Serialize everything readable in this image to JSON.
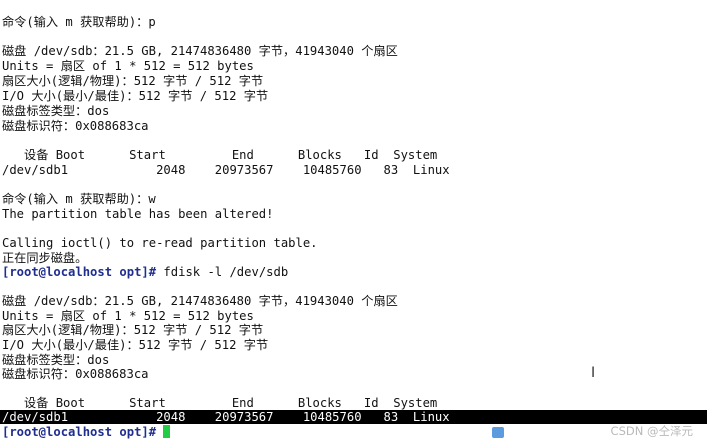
{
  "terminal": {
    "block1": {
      "cmd_prompt_line": "命令(输入 m 获取帮助)：p",
      "disk_line": "磁盘 /dev/sdb：21.5 GB, 21474836480 字节，41943040 个扇区",
      "units_line": "Units = 扇区 of 1 * 512 = 512 bytes",
      "sector_size_line": "扇区大小(逻辑/物理)：512 字节 / 512 字节",
      "io_size_line": "I/O 大小(最小/最佳)：512 字节 / 512 字节",
      "label_type_line": "磁盘标签类型：dos",
      "identifier_line": "磁盘标识符：0x088683ca",
      "table_header": "   设备 Boot      Start         End      Blocks   Id  System",
      "table_row": "/dev/sdb1            2048    20973567    10485760   83  Linux"
    },
    "write_cmd_line": "命令(输入 m 获取帮助)：w",
    "altered_line": "The partition table has been altered!",
    "ioctl_line": "Calling ioctl() to re-read partition table.",
    "sync_line": "正在同步磁盘。",
    "prompt1": "[root@localhost opt]#",
    "command1": " fdisk -l /dev/sdb",
    "block2": {
      "disk_line": "磁盘 /dev/sdb：21.5 GB, 21474836480 字节，41943040 个扇区",
      "units_line": "Units = 扇区 of 1 * 512 = 512 bytes",
      "sector_size_line": "扇区大小(逻辑/物理)：512 字节 / 512 字节",
      "io_size_line": "I/O 大小(最小/最佳)：512 字节 / 512 字节",
      "label_type_line": "磁盘标签类型：dos",
      "identifier_line": "磁盘标识符：0x088683ca",
      "table_header": "   设备 Boot      Start         End      Blocks   Id  System",
      "table_row": "/dev/sdb1            2048    20973567    10485760   83  Linux"
    },
    "prompt2": "[root@localhost opt]#",
    "watermark": "CSDN @仝泽元"
  },
  "icons": {
    "text_cursor": "i-beam-cursor-icon",
    "taskbar": "taskbar-app-icon"
  },
  "colors": {
    "prompt": "#1f2d8f",
    "cursor": "#22cc44",
    "highlight_bg": "#000000"
  }
}
